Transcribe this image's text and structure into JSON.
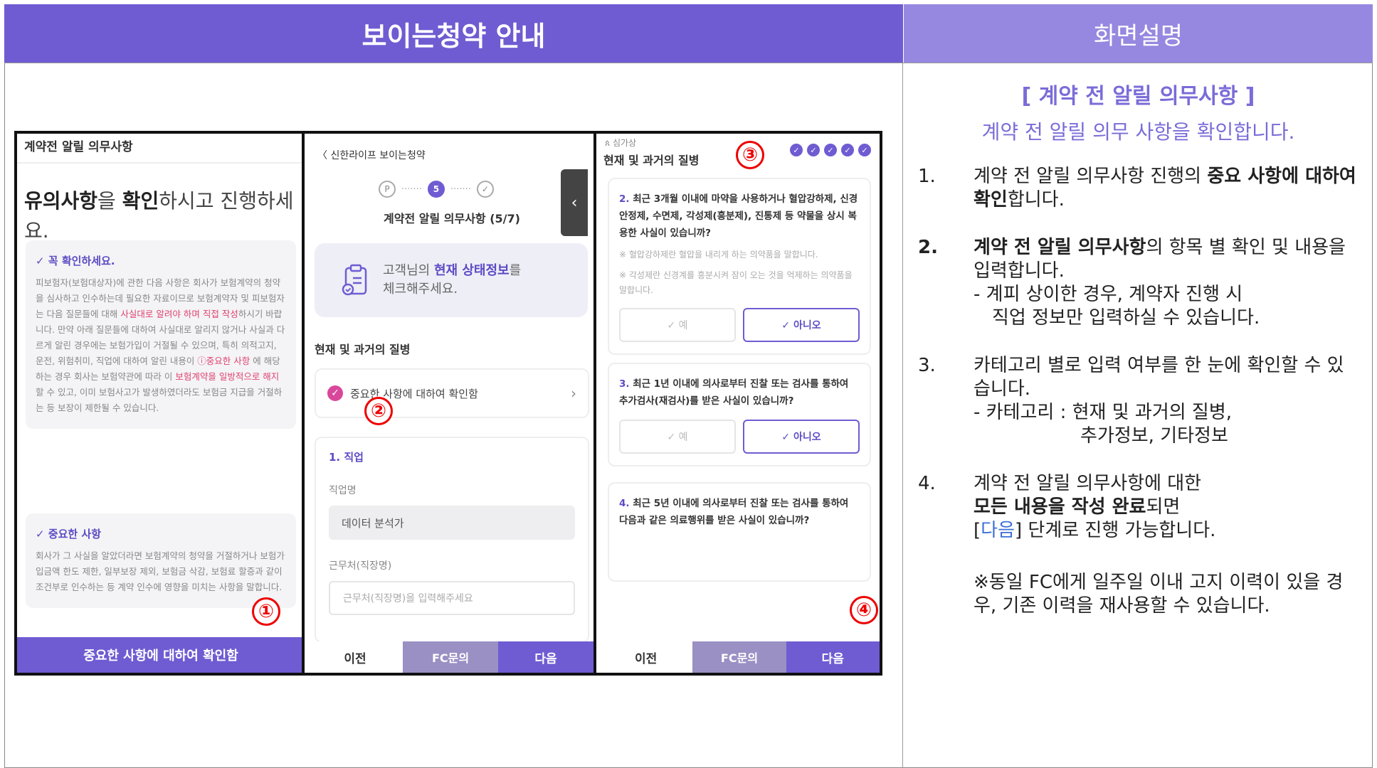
{
  "header": {
    "left_title": "보이는청약 안내",
    "right_title": "화면설명"
  },
  "panel1": {
    "title": "계약전 알릴 의무사항",
    "headline_bold1": "유의사항",
    "headline_mid": "을 ",
    "headline_bold2": "확인",
    "headline_rest": "하시고 진행하세요.",
    "box1_title": "✓ 꼭 확인하세요.",
    "box1_text_a": "피보험자(보험대상자)에 관한 다음 사항은 회사가 보험계약의 청약을 심사하고 인수하는데 필요한 자료이므로 보험계약자 및 피보험자는 다음 질문들에 대해 ",
    "box1_text_pink1": "사실대로 알려야 하며 직접 작성",
    "box1_text_b": "하시기 바랍니다. 만약 아래 질문들에 대하여 사실대로 알리지 않거나 사실과 다르게 알린 경우에는 보험가입이 거절될 수 있으며, 특히 의적고지, 운전, 위험취미, 직업에 대하여 알린 내용이 ",
    "box1_text_pink2": "ⓘ중요한 사항",
    "box1_text_c": " 에 해당하는 경우 회사는 보험약관에 따라 이 ",
    "box1_text_pink3": "보험계약을 일방적으로 해지",
    "box1_text_d": "할 수 있고, 이미 보험사고가 발생하였더라도 보험금 지급을 거절하는 등 보장이 제한될 수 있습니다.",
    "box2_title": "✓ 중요한 사항",
    "box2_text": "회사가 그 사실을 알았더라면 보험계약의 청약을 거절하거나 보험가입금액 한도 제한, 일부보장 제외, 보험금 삭감, 보험료 할증과 같이 조건부로 인수하는 등 계약 인수에 영향을 미치는 사항을 말합니다.",
    "button": "중요한 사항에 대하여 확인함"
  },
  "panel2": {
    "back": "〈  신한라이프 보이는청약",
    "step_prev": "P",
    "step_current": "5",
    "step_title": "계약전 알릴 의무사항 (5/7)",
    "info_line1_a": "고객님의 ",
    "info_line1_b": "현재 상태정보",
    "info_line1_c": "를",
    "info_line2": "체크해주세요.",
    "section": "현재 및 과거의 질병",
    "check_label": "중요한 사항에 대하여 확인함",
    "job_label": "1. 직업",
    "job_name_label": "직업명",
    "job_name_value": "데이터 분석가",
    "workplace_label": "근무처(직장명)",
    "workplace_placeholder": "근무처(직장명)을 입력해주세요",
    "btn_prev": "이전",
    "btn_fc": "FC문의",
    "btn_next": "다음"
  },
  "panel3": {
    "category": "ጰ 심가상",
    "title": "현재 및 과거의 질병",
    "q2_num": "2.",
    "q2_text": "최근 3개월 이내에 마약을 사용하거나 혈압강하제, 신경안정제, 수면제, 각성제(흥분제), 진통제 등 약물을 상시 복용한 사실이 있습니까?",
    "q2_note1": "※ 혈압강하제란 혈압을 내리게 하는 의약품을 말합니다.",
    "q2_note2": "※ 각성제란 신경계를 흥분시켜 잠이 오는 것을 억제하는 의약품을 말합니다.",
    "q3_num": "3.",
    "q3_text": "최근 1년 이내에 의사로부터 진찰 또는 검사를 통하여 추가검사(재검사)를 받은 사실이 있습니까?",
    "q4_num": "4.",
    "q4_text": "최근 5년 이내에 의사로부터 진찰 또는 검사를 통하여 다음과 같은 의료행위를 받은 사실이 있습니까?",
    "yes": "✓ 예",
    "no": "✓ 아니오",
    "btn_prev": "이전",
    "btn_fc": "FC문의",
    "btn_next": "다음"
  },
  "markers": [
    "①",
    "②",
    "③",
    "④"
  ],
  "description": {
    "title": "[ 계약 전 알릴 의무사항 ]",
    "subtitle": "계약 전 알릴 의무 사항을 확인합니다.",
    "item1_num": "1.",
    "item1_a": "계약 전 알릴 의무사항 진행의 ",
    "item1_b": "중요 사항에 대하여 확인",
    "item1_c": "합니다.",
    "item2_num": "2.",
    "item2_b": "계약 전 알릴 의무사항",
    "item2_c": "의 항목 별 확인 및 내용을 입력합니다.",
    "item2_d": "- 계피 상이한 경우, 계약자 진행 시",
    "item2_e": "직업 정보만 입력하실 수 있습니다.",
    "item3_num": "3.",
    "item3_a": "카테고리 별로 입력 여부를 한 눈에 확인할 수 있습니다.",
    "item3_b": "- 카테고리 : 현재 및 과거의 질병,",
    "item3_c": "추가정보, 기타정보",
    "item4_num": "4.",
    "item4_a": "계약 전 알릴 의무사항에 대한",
    "item4_b": "모든 내용을 작성 완료",
    "item4_c": "되면",
    "item4_d_open": "[",
    "item4_d_link": "다음",
    "item4_d_close": "] 단계로 진행 가능합니다.",
    "note": "※동일 FC에게 일주일 이내 고지 이력이 있을 경우, 기존 이력을 재사용할 수 있습니다."
  },
  "colors": {
    "header_left": "#6f5cd2",
    "header_right": "#9688e0",
    "accent": "#6f5cd2",
    "marker": "#e00000",
    "pink": "#e0416f"
  }
}
